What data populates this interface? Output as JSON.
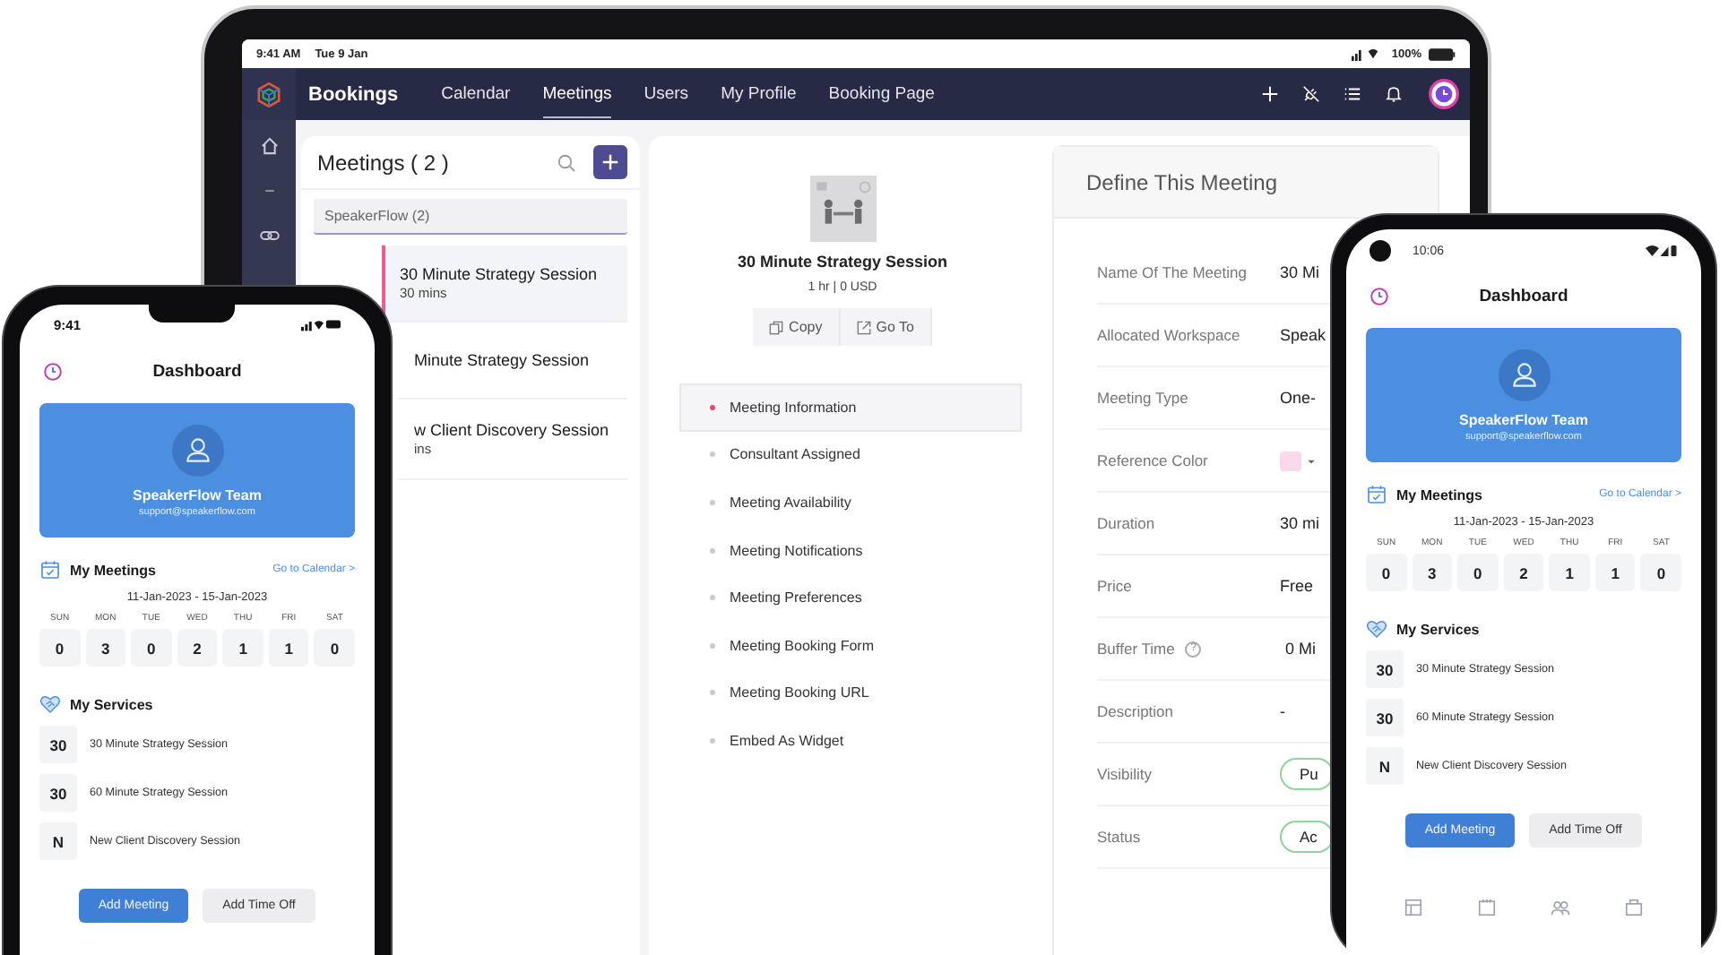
{
  "tablet": {
    "status_bar": {
      "time": "9:41 AM",
      "date": "Tue 9 Jan",
      "battery": "100%"
    },
    "nav": {
      "brand": "Bookings",
      "tabs": [
        {
          "label": "Calendar",
          "selected": false
        },
        {
          "label": "Meetings",
          "selected": true
        },
        {
          "label": "Users",
          "selected": false
        },
        {
          "label": "My Profile",
          "selected": false
        },
        {
          "label": "Booking Page",
          "selected": false
        }
      ]
    },
    "meetings_panel": {
      "title": "Meetings ( 2 )",
      "group_tab": {
        "label": "SpeakerFlow (2)",
        "selected": true
      },
      "items": [
        {
          "title": "30 Minute Strategy Session",
          "subtitle": "30 mins",
          "selected": true
        },
        {
          "title": "Minute Strategy Session",
          "selected": false
        },
        {
          "title": "w Client Discovery Session",
          "subtitle": "ins",
          "selected": false
        }
      ]
    },
    "detail": {
      "title": "30 Minute Strategy Session",
      "meta": "1 hr | 0 USD",
      "actions": [
        "Copy",
        "Go To"
      ],
      "sections": [
        {
          "label": "Meeting Information",
          "selected": true
        },
        {
          "label": "Consultant Assigned",
          "selected": false
        },
        {
          "label": "Meeting Availability",
          "selected": false
        },
        {
          "label": "Meeting Notifications",
          "selected": false
        },
        {
          "label": "Meeting Preferences",
          "selected": false
        },
        {
          "label": "Meeting Booking Form",
          "selected": false
        },
        {
          "label": "Meeting Booking URL",
          "selected": false
        },
        {
          "label": "Embed As Widget",
          "selected": false
        }
      ]
    },
    "define_panel": {
      "title": "Define This Meeting",
      "fields": [
        {
          "label": "Name Of The Meeting",
          "kind": "text",
          "value": "30 Mi"
        },
        {
          "label": "Allocated Workspace",
          "kind": "text",
          "value": "Speak"
        },
        {
          "label": "Meeting Type",
          "kind": "text",
          "value": "One-"
        },
        {
          "label": "Reference Color",
          "kind": "color",
          "color": "#fad9ec"
        },
        {
          "label": "Duration",
          "kind": "text",
          "value": "30 mi"
        },
        {
          "label": "Price",
          "kind": "text",
          "value": "Free"
        },
        {
          "label": "Buffer Time",
          "kind": "text",
          "value": "0 Mi",
          "hint": "?"
        },
        {
          "label": "Description",
          "kind": "text",
          "value": "-"
        },
        {
          "label": "Visibility",
          "kind": "pill",
          "value": "Pu"
        },
        {
          "label": "Status",
          "kind": "pill",
          "value": "Ac"
        }
      ]
    }
  },
  "phones": [
    {
      "kind": "ios",
      "time": "9:41",
      "title": "Dashboard",
      "profile": {
        "name": "SpeakerFlow Team",
        "email": "support@speakerflow.com"
      },
      "meetings": {
        "title": "My Meetings",
        "link": "Go to Calendar >",
        "range": "11-Jan-2023 - 15-Jan-2023",
        "days": [
          {
            "day": "SUN",
            "count": "0"
          },
          {
            "day": "MON",
            "count": "3"
          },
          {
            "day": "TUE",
            "count": "0"
          },
          {
            "day": "WED",
            "count": "2"
          },
          {
            "day": "THU",
            "count": "1"
          },
          {
            "day": "FRI",
            "count": "1"
          },
          {
            "day": "SAT",
            "count": "0"
          }
        ]
      },
      "services": {
        "title": "My Services",
        "items": [
          {
            "badge": "30",
            "name": "30 Minute Strategy Session"
          },
          {
            "badge": "30",
            "name": "60 Minute Strategy Session"
          },
          {
            "badge": "N",
            "name": "New Client Discovery Session"
          }
        ]
      },
      "buttons": [
        {
          "label": "Add Meeting",
          "kind": "primary"
        },
        {
          "label": "Add Time Off",
          "kind": "secondary"
        }
      ]
    },
    {
      "kind": "android",
      "time": "10:06",
      "title": "Dashboard",
      "profile": {
        "name": "SpeakerFlow Team",
        "email": "support@speakerflow.com"
      },
      "meetings": {
        "title": "My Meetings",
        "link": "Go to Calendar >",
        "range": "11-Jan-2023 - 15-Jan-2023",
        "days": [
          {
            "day": "SUN",
            "count": "0"
          },
          {
            "day": "MON",
            "count": "3"
          },
          {
            "day": "TUE",
            "count": "0"
          },
          {
            "day": "WED",
            "count": "2"
          },
          {
            "day": "THU",
            "count": "1"
          },
          {
            "day": "FRI",
            "count": "1"
          },
          {
            "day": "SAT",
            "count": "0"
          }
        ]
      },
      "services": {
        "title": "My Services",
        "items": [
          {
            "badge": "30",
            "name": "30 Minute Strategy Session"
          },
          {
            "badge": "30",
            "name": "60 Minute Strategy Session"
          },
          {
            "badge": "N",
            "name": "New Client Discovery Session"
          }
        ]
      },
      "buttons": [
        {
          "label": "Add Meeting",
          "kind": "primary"
        },
        {
          "label": "Add Time Off",
          "kind": "secondary"
        }
      ]
    }
  ]
}
